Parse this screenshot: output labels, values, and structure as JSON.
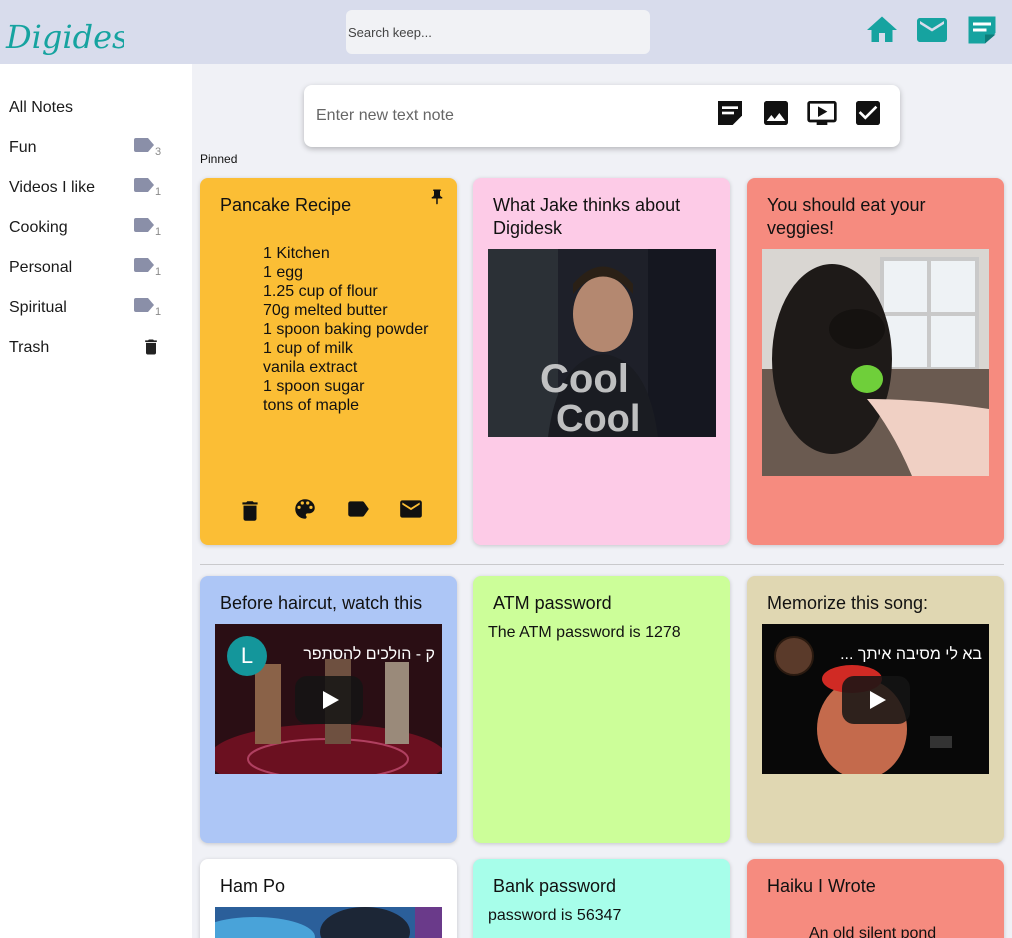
{
  "app": {
    "logo_text": "Digidesk",
    "search_placeholder": "Search keep..."
  },
  "header_icons": [
    "home-icon",
    "mail-icon",
    "note-icon"
  ],
  "sidebar": {
    "items": [
      {
        "label": "All Notes"
      },
      {
        "label": "Fun",
        "count": "3"
      },
      {
        "label": "Videos I like",
        "count": "1"
      },
      {
        "label": "Cooking",
        "count": "1"
      },
      {
        "label": "Personal",
        "count": "1"
      },
      {
        "label": "Spiritual",
        "count": "1"
      },
      {
        "label": "Trash"
      }
    ]
  },
  "composer": {
    "placeholder": "Enter new text note",
    "icons": [
      "text-note-icon",
      "image-icon",
      "video-icon",
      "todo-icon"
    ]
  },
  "pinned_label": "Pinned",
  "colors": {
    "yellow": "#fbbe35",
    "pink": "#fdcbe7",
    "salmon": "#f68b7f",
    "blue": "#adc6f6",
    "green": "#ccfe99",
    "beige": "#e0d7b2",
    "white": "#ffffff",
    "cyan": "#a7feea"
  },
  "notes": {
    "pancake": {
      "title": "Pancake Recipe",
      "items": [
        "1 Kitchen",
        "1 egg",
        "1.25 cup of flour",
        "70g melted butter",
        "1 spoon baking powder",
        "1 cup of milk",
        "vanila extract",
        "1 spoon sugar",
        "tons of maple"
      ]
    },
    "jake": {
      "title": "What Jake thinks about Digidesk",
      "gif_caption_1": "Cool",
      "gif_caption_2": "Cool"
    },
    "veggies": {
      "title": "You should eat your veggies!"
    },
    "haircut": {
      "title": "Before haircut, watch this",
      "video_title": "ק - הולכים להסתפר",
      "avatar_letter": "L"
    },
    "atm": {
      "title": "ATM password",
      "text": "The ATM password is 1278"
    },
    "song": {
      "title": "Memorize this song:",
      "video_title": "בא לי מסיבה איתך ..."
    },
    "ham": {
      "title": "Ham Po"
    },
    "bank": {
      "title": "Bank password",
      "text": "password is 56347"
    },
    "haiku": {
      "title": "Haiku I Wrote",
      "text": "An old silent pond"
    }
  }
}
